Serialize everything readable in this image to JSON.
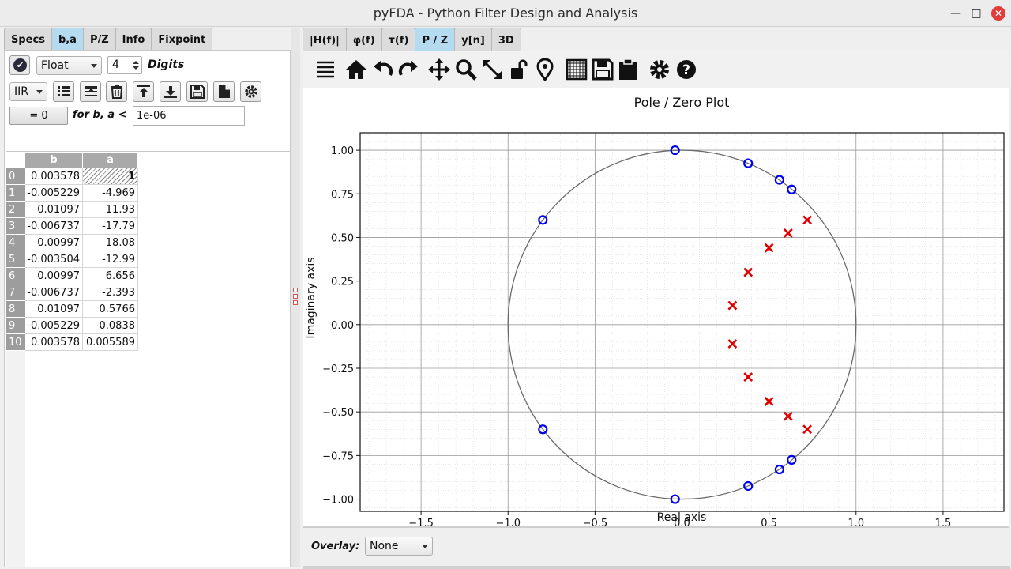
{
  "window": {
    "title": "pyFDA - Python Filter Design and Analysis"
  },
  "left": {
    "tabs": [
      "Specs",
      "b,a",
      "P/Z",
      "Info",
      "Fixpoint"
    ],
    "active_tab": "b,a",
    "format": "Float",
    "digits_value": "4",
    "digits_label": "Digits",
    "filter_type": "IIR",
    "zero_button": "= 0",
    "threshold_label": "for b, a <",
    "threshold_value": "1e-06",
    "columns": [
      "b",
      "a"
    ],
    "rows": [
      {
        "i": "0",
        "b": "0.003578",
        "a": "1"
      },
      {
        "i": "1",
        "b": "-0.005229",
        "a": "-4.969"
      },
      {
        "i": "2",
        "b": "0.01097",
        "a": "11.93"
      },
      {
        "i": "3",
        "b": "-0.006737",
        "a": "-17.79"
      },
      {
        "i": "4",
        "b": "0.00997",
        "a": "18.08"
      },
      {
        "i": "5",
        "b": "-0.003504",
        "a": "-12.99"
      },
      {
        "i": "6",
        "b": "0.00997",
        "a": "6.656"
      },
      {
        "i": "7",
        "b": "-0.006737",
        "a": "-2.393"
      },
      {
        "i": "8",
        "b": "0.01097",
        "a": "0.5766"
      },
      {
        "i": "9",
        "b": "-0.005229",
        "a": "-0.0838"
      },
      {
        "i": "10",
        "b": "0.003578",
        "a": "0.005589"
      }
    ]
  },
  "right": {
    "tabs": [
      "|H(f)|",
      "φ(f)",
      "τ(f)",
      "P / Z",
      "y[n]",
      "3D"
    ],
    "active_tab": "P / Z",
    "overlay_label": "Overlay:",
    "overlay_value": "None"
  },
  "chart_data": {
    "type": "scatter",
    "title": "Pole / Zero Plot",
    "xlabel": "Real axis",
    "ylabel": "Imaginary axis",
    "xlim": [
      -1.85,
      1.85
    ],
    "ylim": [
      -1.07,
      1.1
    ],
    "xticks": [
      "−1.5",
      "−1.0",
      "−0.5",
      "0.0",
      "0.5",
      "1.0",
      "1.5"
    ],
    "xtick_values": [
      -1.5,
      -1.0,
      -0.5,
      0.0,
      0.5,
      1.0,
      1.5
    ],
    "yticks": [
      "−1.00",
      "−0.75",
      "−0.50",
      "−0.25",
      "0.00",
      "0.25",
      "0.50",
      "0.75",
      "1.00"
    ],
    "ytick_values": [
      -1.0,
      -0.75,
      -0.5,
      -0.25,
      0.0,
      0.25,
      0.5,
      0.75,
      1.0
    ],
    "grid": true,
    "unit_circle": true,
    "series": [
      {
        "marker": "o",
        "color": "#0000ee",
        "points": [
          [
            -0.04,
            1.0
          ],
          [
            0.38,
            0.925
          ],
          [
            0.56,
            0.83
          ],
          [
            0.63,
            0.775
          ],
          [
            -0.8,
            0.6
          ],
          [
            -0.04,
            -1.0
          ],
          [
            0.38,
            -0.925
          ],
          [
            0.56,
            -0.83
          ],
          [
            0.63,
            -0.775
          ],
          [
            -0.8,
            -0.6
          ]
        ]
      },
      {
        "marker": "x",
        "color": "#e00000",
        "points": [
          [
            0.72,
            0.6
          ],
          [
            0.61,
            0.525
          ],
          [
            0.5,
            0.44
          ],
          [
            0.38,
            0.3
          ],
          [
            0.29,
            0.11
          ],
          [
            0.72,
            -0.6
          ],
          [
            0.61,
            -0.525
          ],
          [
            0.5,
            -0.44
          ],
          [
            0.38,
            -0.3
          ],
          [
            0.29,
            -0.11
          ]
        ]
      }
    ]
  }
}
